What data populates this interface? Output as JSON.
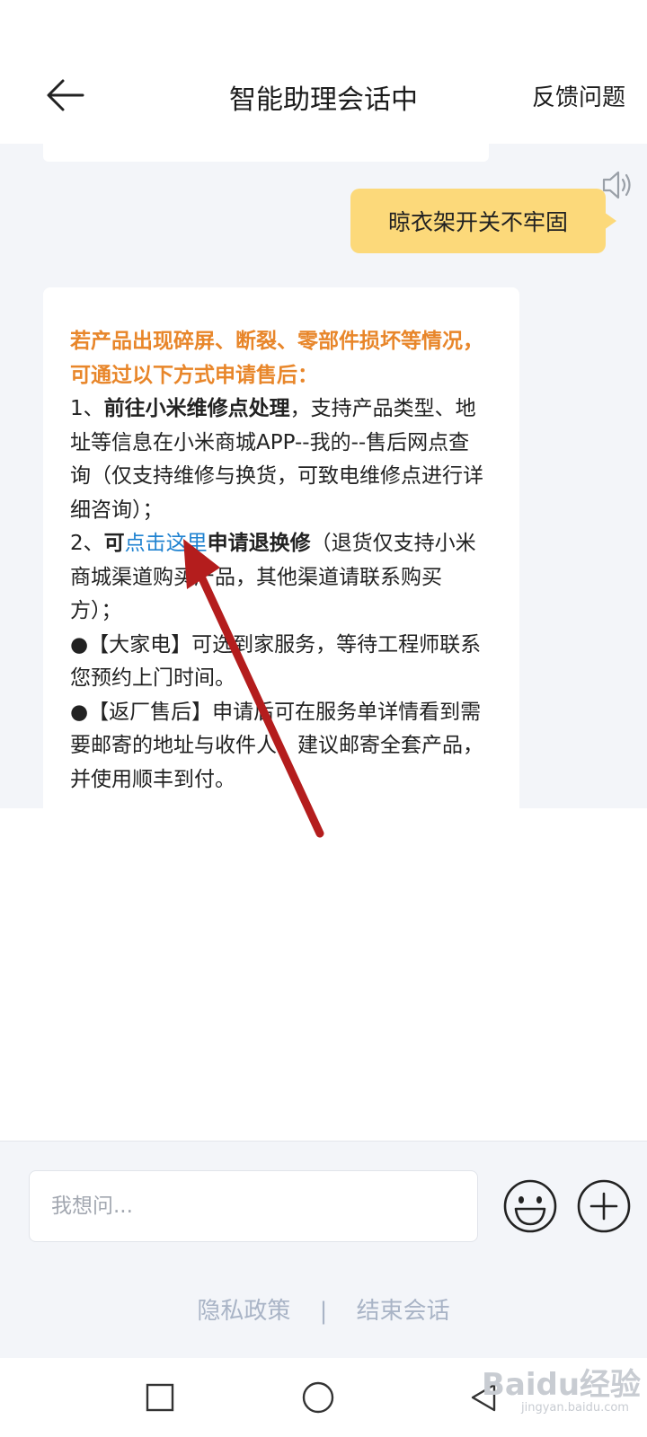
{
  "header": {
    "title": "智能助理会话中",
    "feedback_label": "反馈问题"
  },
  "chat": {
    "user_message": "晾衣架开关不牢固",
    "bot_message": {
      "intro": "若产品出现碎屏、断裂、零部件损坏等情况，可通过以下方式申请售后：",
      "item1_prefix": "1、",
      "item1_bold": "前往小米维修点处理",
      "item1_text": "，支持产品类型、地址等信息在小米商城APP--我的--售后网点查询（仅支持维修与换货，可致电维修点进行详细咨询）；",
      "item2_prefix": "2、",
      "item2_bold1": "可",
      "item2_link": "点击这里",
      "item2_bold2": "申请退换修",
      "item2_text": "（退货仅支持小米商城渠道购买产品，其他渠道请联系购买方）；",
      "bullet1_mark": "●",
      "bullet1_tag": "【大家电】",
      "bullet1_text": "可选到家服务，等待工程师联系您预约上门时间。",
      "bullet2_mark": "●",
      "bullet2_tag": "【返厂售后】",
      "bullet2_text": "申请后可在服务单详情看到需要邮寄的地址与收件人，建议邮寄全套产品，并使用顺丰到付。"
    }
  },
  "input": {
    "placeholder": "我想问..."
  },
  "footer": {
    "privacy_label": "隐私政策",
    "separator": "|",
    "end_label": "结束会话"
  },
  "watermark": {
    "brand": "Baidu经验",
    "domain": "jingyan.baidu.com"
  },
  "colors": {
    "user_bubble": "#fcd97a",
    "accent_orange": "#e8862a",
    "link_blue": "#1f82d0",
    "annotation_arrow": "#b41d1d"
  },
  "icons": [
    "back-arrow-icon",
    "speaker-icon",
    "emoji-icon",
    "plus-icon",
    "square-nav-icon",
    "circle-nav-icon",
    "triangle-back-nav-icon"
  ]
}
